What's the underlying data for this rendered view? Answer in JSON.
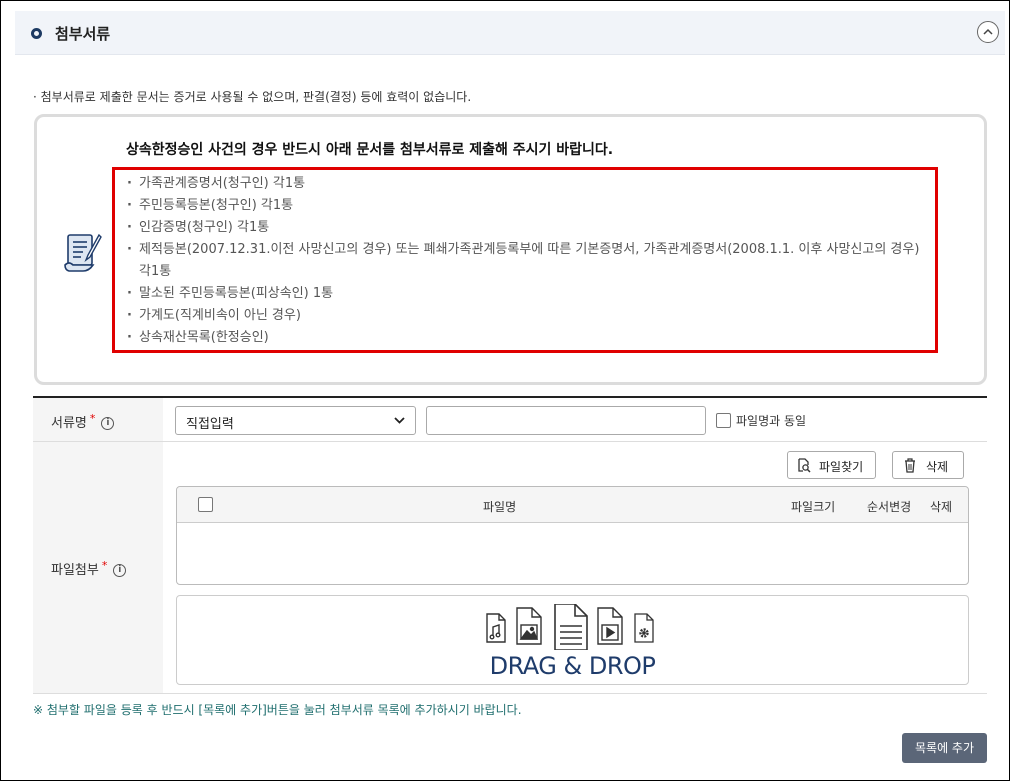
{
  "section": {
    "title": "첨부서류"
  },
  "notice": "첨부서류로 제출한 문서는 증거로 사용될 수 없으며, 판결(결정) 등에 효력이 없습니다.",
  "info": {
    "title": "상속한정승인 사건의 경우 반드시 아래 문서를 첨부서류로 제출해 주시기 바랍니다.",
    "items": [
      "가족관계증명서(청구인) 각1통",
      "주민등록등본(청구인) 각1통",
      "인감증명(청구인) 각1통",
      "제적등본(2007.12.31.이전 사망신고의 경우) 또는 폐쇄가족관계등록부에 따른 기본증명서, 가족관계증명서(2008.1.1. 이후 사망신고의 경우) 각1통",
      "말소된 주민등록등본(피상속인) 1통",
      "가계도(직계비속이 아닌 경우)",
      "상속재산목록(한정승인)"
    ]
  },
  "form": {
    "doc_name_label": "서류명",
    "required_mark": "*",
    "select_value": "직접입력",
    "same_as_file_label": "파일명과 동일",
    "attach_label": "파일첨부",
    "find_file_button": "파일찾기",
    "delete_button": "삭제",
    "table_headers": {
      "name": "파일명",
      "size": "파일크기",
      "order": "순서변경",
      "delete": "삭제"
    },
    "drag_drop": "DRAG & DROP"
  },
  "bottom_note": "※ 첨부할 파일을 등록 후 반드시 [목록에 추가]버튼을 눌러 첨부서류 목록에 추가하시기 바랍니다.",
  "add_to_list_button": "목록에 추가",
  "icons": {
    "section": "circle-bullet-icon",
    "collapse": "chevron-up-icon",
    "doc": "document-pen-icon",
    "info": "info-icon",
    "find": "file-search-icon",
    "trash": "trash-icon"
  },
  "colors": {
    "navy": "#1f3c6b",
    "highlight": "#e00000",
    "button": "#5b6678"
  }
}
